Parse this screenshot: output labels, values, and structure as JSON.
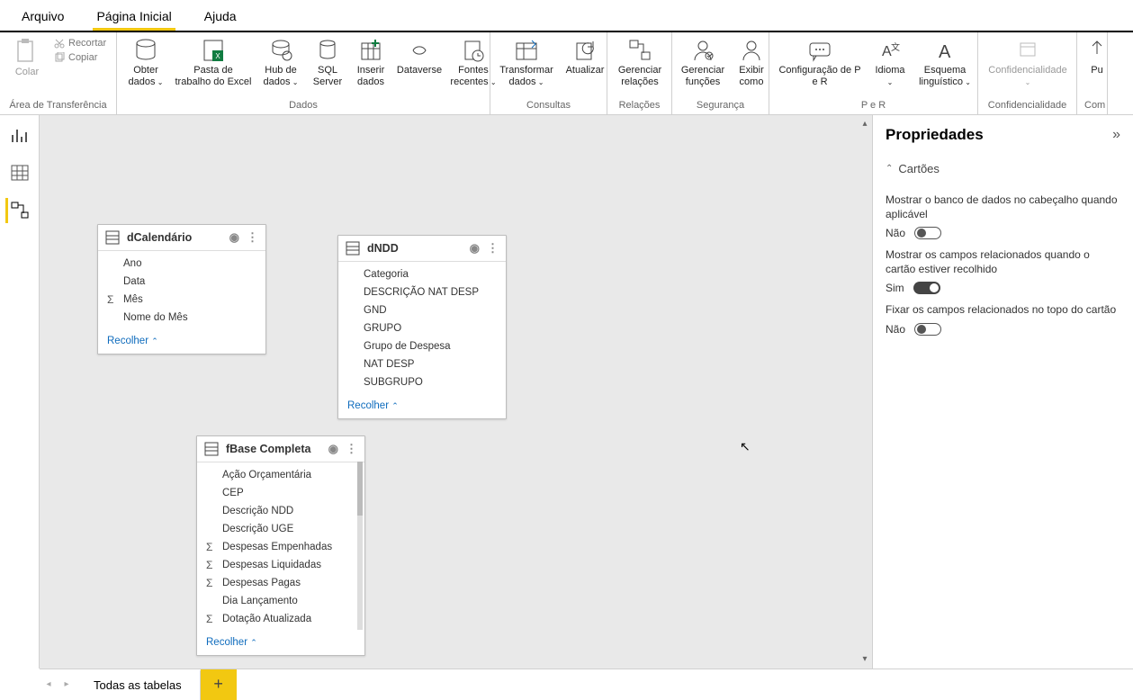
{
  "menu": {
    "arquivo": "Arquivo",
    "inicial": "Página Inicial",
    "ajuda": "Ajuda"
  },
  "ribbon": {
    "clipboard": {
      "paste": "Colar",
      "cut": "Recortar",
      "copy": "Copiar",
      "group": "Área de Transferência"
    },
    "data": {
      "get": "Obter dados",
      "excel": "Pasta de trabalho do Excel",
      "hub": "Hub de dados",
      "sql": "SQL Server",
      "insert": "Inserir dados",
      "dataverse": "Dataverse",
      "recent": "Fontes recentes",
      "group": "Dados"
    },
    "queries": {
      "transform": "Transformar dados",
      "refresh": "Atualizar",
      "group": "Consultas"
    },
    "relations": {
      "manage": "Gerenciar relações",
      "group": "Relações"
    },
    "security": {
      "roles": "Gerenciar funções",
      "viewas": "Exibir como",
      "group": "Segurança"
    },
    "qa": {
      "config": "Configuração de P e R",
      "lang": "Idioma",
      "schema": "Esquema linguístico",
      "group": "P e R"
    },
    "conf": {
      "label": "Confidencialidade",
      "group": "Confidencialidade"
    },
    "share": {
      "label": "Pu",
      "group": "Com"
    }
  },
  "cards": {
    "dcal": {
      "title": "dCalendário",
      "recolher": "Recolher",
      "fields": [
        "Ano",
        "Data",
        "Mês",
        "Nome do Mês"
      ],
      "sigma": [
        false,
        false,
        true,
        false
      ]
    },
    "dndd": {
      "title": "dNDD",
      "recolher": "Recolher",
      "fields": [
        "Categoria",
        "DESCRIÇÃO NAT DESP",
        "GND",
        "GRUPO",
        "Grupo de Despesa",
        "NAT DESP",
        "SUBGRUPO"
      ],
      "sigma": [
        false,
        false,
        false,
        false,
        false,
        false,
        false
      ]
    },
    "fbase": {
      "title": "fBase Completa",
      "recolher": "Recolher",
      "fields": [
        "Ação Orçamentária",
        "CEP",
        "Descrição NDD",
        "Descrição UGE",
        "Despesas Empenhadas",
        "Despesas Liquidadas",
        "Despesas Pagas",
        "Dia Lançamento",
        "Dotação Atualizada"
      ],
      "sigma": [
        false,
        false,
        false,
        false,
        true,
        true,
        true,
        false,
        true
      ]
    }
  },
  "props": {
    "title": "Propriedades",
    "section": "Cartões",
    "item1": "Mostrar o banco de dados no cabeçalho quando aplicável",
    "item1_val": "Não",
    "item2": "Mostrar os campos relacionados quando o cartão estiver recolhido",
    "item2_val": "Sim",
    "item3": "Fixar os campos relacionados no topo do cartão",
    "item3_val": "Não"
  },
  "bottom": {
    "tab": "Todas as tabelas"
  }
}
